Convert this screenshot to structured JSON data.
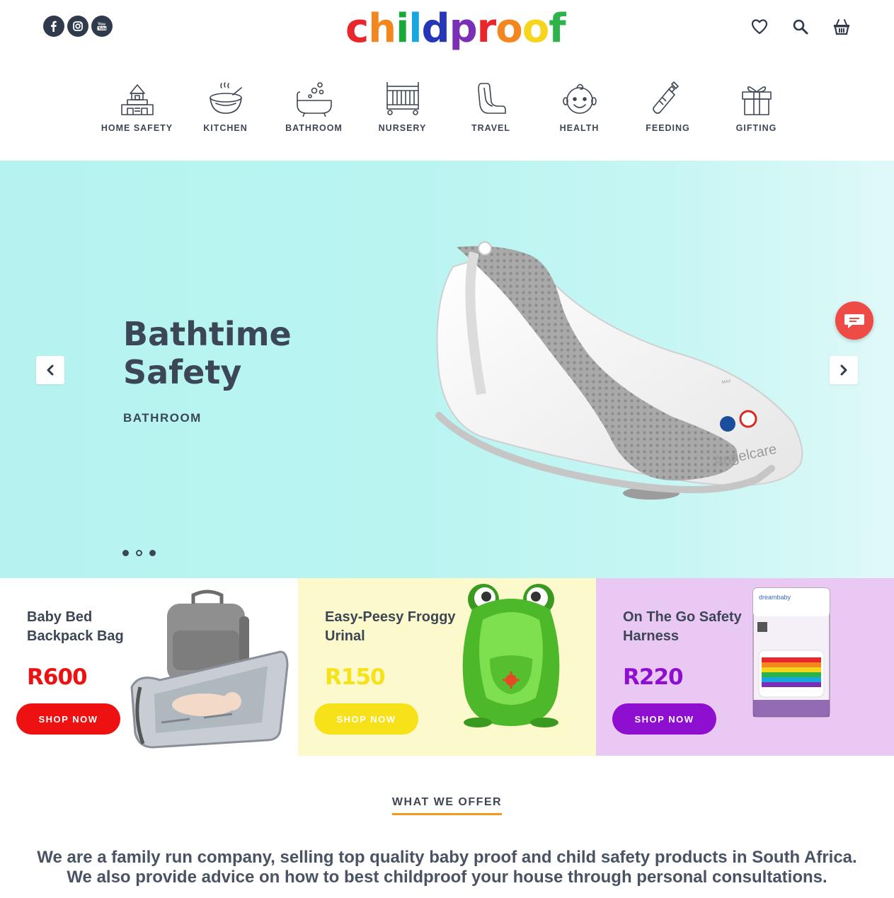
{
  "header": {
    "logo_letters": [
      {
        "char": "c",
        "color": "#e8262b"
      },
      {
        "char": "h",
        "color": "#f4861f"
      },
      {
        "char": "i",
        "color": "#1aa83a"
      },
      {
        "char": "l",
        "color": "#17a6df"
      },
      {
        "char": "d",
        "color": "#2537b8"
      },
      {
        "char": "p",
        "color": "#7a2fb6"
      },
      {
        "char": "r",
        "color": "#e8262b"
      },
      {
        "char": "o",
        "color": "#f4861f"
      },
      {
        "char": "o",
        "color": "#f7d51c"
      },
      {
        "char": "f",
        "color": "#2db34a"
      }
    ],
    "socials": [
      "facebook-icon",
      "instagram-icon",
      "youtube-icon"
    ],
    "actions": [
      "wishlist-heart-icon",
      "search-icon",
      "cart-basket-icon"
    ]
  },
  "categories": [
    {
      "label": "HOME SAFETY",
      "icon": "house-blocks-icon"
    },
    {
      "label": "KITCHEN",
      "icon": "bowl-icon"
    },
    {
      "label": "BATHROOM",
      "icon": "bathtub-icon"
    },
    {
      "label": "NURSERY",
      "icon": "crib-icon"
    },
    {
      "label": "TRAVEL",
      "icon": "car-seat-icon"
    },
    {
      "label": "HEALTH",
      "icon": "baby-face-icon"
    },
    {
      "label": "FEEDING",
      "icon": "baby-bottle-icon"
    },
    {
      "label": "GIFTING",
      "icon": "gift-box-icon"
    }
  ],
  "hero": {
    "title_line1": "Bathtime",
    "title_line2": "Safety",
    "subtitle": "BATHROOM",
    "slide_count": 3,
    "active_slide": 2,
    "product_brand": "Angelcare"
  },
  "promos": [
    {
      "title": "Baby Bed Backpack Bag",
      "price": "R600",
      "button": "SHOP NOW",
      "accent": "#ee1111"
    },
    {
      "title": "Easy-Peesy Froggy Urinal",
      "price": "R150",
      "button": "SHOP NOW",
      "accent": "#f7e21a"
    },
    {
      "title": "On The Go Safety Harness",
      "price": "R220",
      "button": "SHOP NOW",
      "accent": "#8e0fcf"
    }
  ],
  "offer": {
    "heading": "WHAT WE OFFER",
    "text": "We  are a family run company, selling top quality baby proof and child safety products in South Africa. We also provide advice on how to best childproof your house through personal consultations."
  }
}
